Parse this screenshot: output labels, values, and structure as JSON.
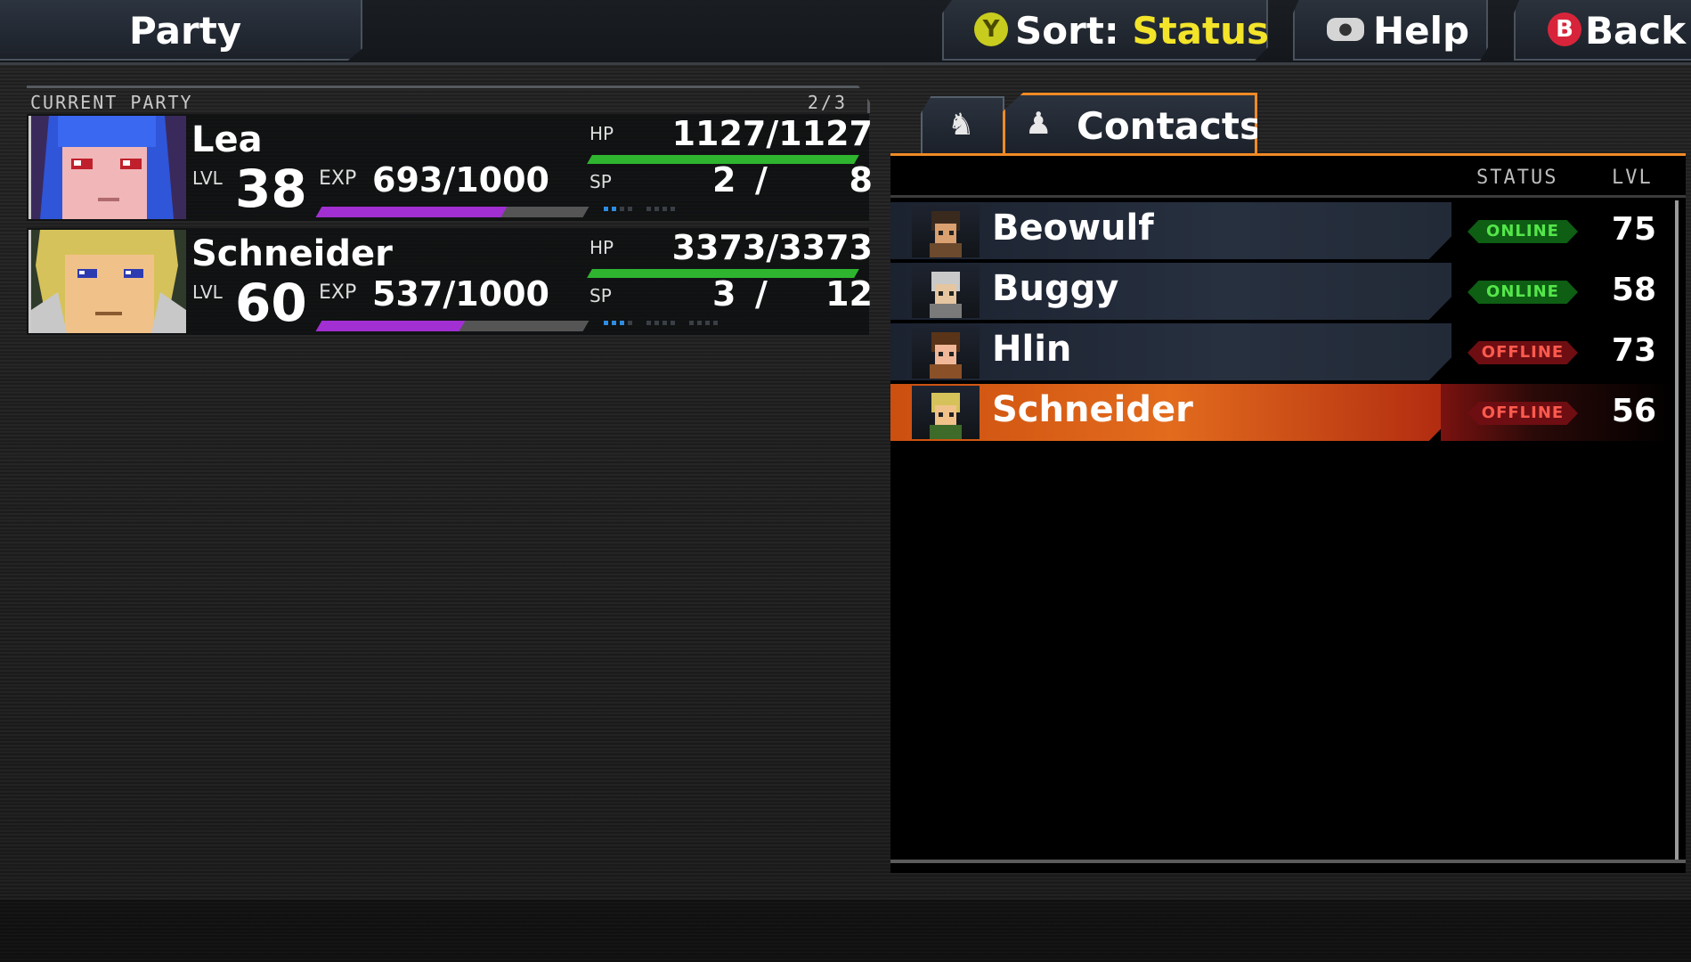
{
  "header": {
    "title": "Party",
    "sort": {
      "button_glyph": "Y",
      "label": "Sort:",
      "value": "Status"
    },
    "help": {
      "button_glyph": "●",
      "label": "Help"
    },
    "back": {
      "button_glyph": "B",
      "label": "Back"
    }
  },
  "current_party": {
    "label": "CURRENT PARTY",
    "count": "2/3",
    "members": [
      {
        "name": "Lea",
        "level_label": "LVL",
        "level": "38",
        "exp_label": "EXP",
        "exp": "693/1000",
        "exp_fraction": 0.693,
        "hp_label": "HP",
        "hp": "1127/1127",
        "hp_fraction": 1.0,
        "sp_label": "SP",
        "sp_current": "2",
        "sp_max": "8",
        "sp_fraction": 0.25,
        "colors": {
          "hair": "#2f55d9",
          "skin": "#f0b6b8",
          "eyes": "#c0202c",
          "bg": "#3a2a5c"
        }
      },
      {
        "name": "Schneider",
        "level_label": "LVL",
        "level": "60",
        "exp_label": "EXP",
        "exp": "537/1000",
        "exp_fraction": 0.537,
        "hp_label": "HP",
        "hp": "3373/3373",
        "hp_fraction": 1.0,
        "sp_label": "SP",
        "sp_current": "3",
        "sp_max": "12",
        "sp_fraction": 0.25,
        "colors": {
          "hair": "#d6c25a",
          "skin": "#f0c28a",
          "eyes": "#2c3bb0",
          "bg": "#2f3a2a"
        }
      }
    ]
  },
  "contacts": {
    "tab_friends_icon": "person-heart-icon",
    "tab_label": "Contacts",
    "column_status": "STATUS",
    "column_level": "LVL",
    "rows": [
      {
        "name": "Beowulf",
        "status": "ONLINE",
        "status_type": "online",
        "level": "75",
        "selected": false
      },
      {
        "name": "Buggy",
        "status": "ONLINE",
        "status_type": "online",
        "level": "58",
        "selected": false
      },
      {
        "name": "Hlin",
        "status": "OFFLINE",
        "status_type": "offline",
        "level": "73",
        "selected": false
      },
      {
        "name": "Schneider",
        "status": "OFFLINE",
        "status_type": "offline",
        "level": "56",
        "selected": true
      }
    ]
  },
  "colors": {
    "accent_orange": "#f08a25",
    "sort_yellow": "#f3e42a",
    "hp_green": "#2fb42f",
    "exp_purple": "#a22fd2",
    "sp_blue": "#2e8de2",
    "online_green": "#54e64a",
    "offline_red": "#ff5a4e"
  }
}
